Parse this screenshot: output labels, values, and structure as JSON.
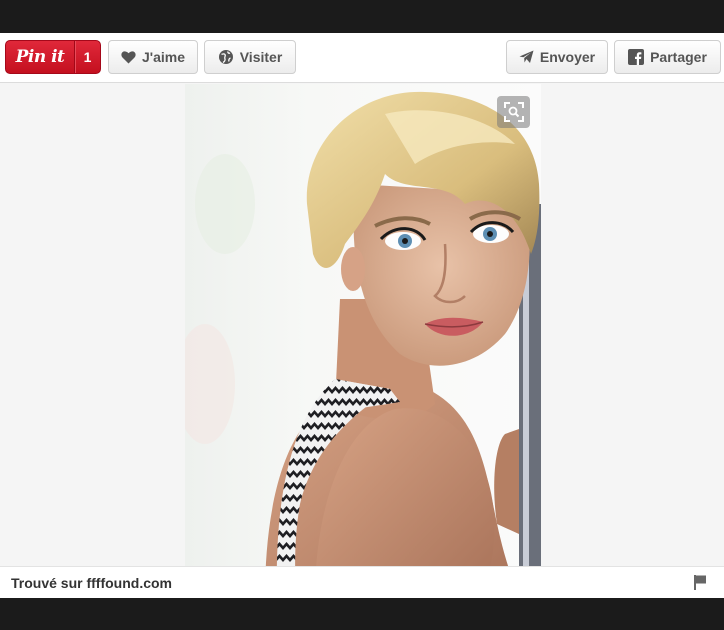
{
  "toolbar": {
    "pinit_label": "Pin it",
    "pinit_count": "1",
    "like_label": "J'aime",
    "visit_label": "Visiter",
    "send_label": "Envoyer",
    "share_label": "Partager"
  },
  "icons": {
    "like": "heart-icon",
    "visit": "globe-icon",
    "send": "paper-plane-icon",
    "share": "facebook-icon",
    "zoom": "zoom-icon",
    "flag": "flag-icon"
  },
  "footer": {
    "source_text": "Trouvé sur ffffound.com"
  },
  "colors": {
    "pinit_red": "#c4101f",
    "page_bg": "#f5f5f5",
    "frame_dark": "#1b1b1b"
  }
}
